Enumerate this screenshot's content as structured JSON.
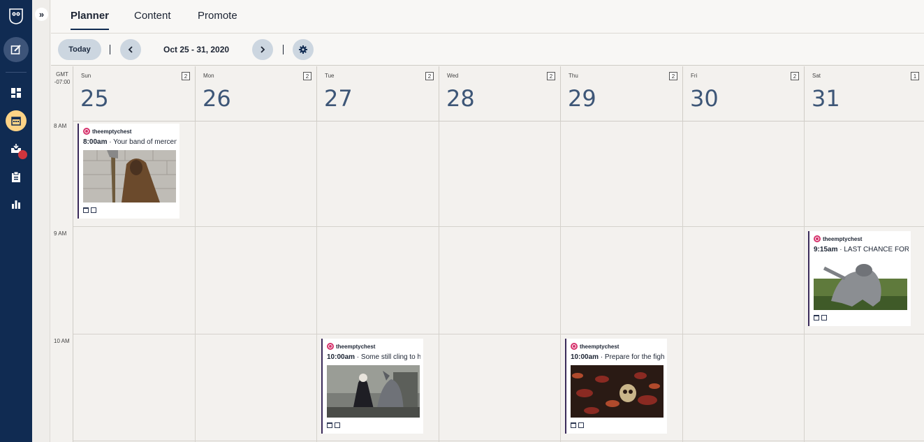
{
  "tabs": [
    {
      "label": "Planner"
    },
    {
      "label": "Content"
    },
    {
      "label": "Promote"
    }
  ],
  "collapse_label": "»",
  "toolbar": {
    "today_label": "Today",
    "date_range": "Oct 25 - 31, 2020"
  },
  "timezone": {
    "line1": "GMT",
    "line2": "-07:00"
  },
  "days": [
    {
      "dow": "Sun",
      "num": "25",
      "count": "2"
    },
    {
      "dow": "Mon",
      "num": "26",
      "count": "2"
    },
    {
      "dow": "Tue",
      "num": "27",
      "count": "2"
    },
    {
      "dow": "Wed",
      "num": "28",
      "count": "2"
    },
    {
      "dow": "Thu",
      "num": "29",
      "count": "2"
    },
    {
      "dow": "Fri",
      "num": "30",
      "count": "2"
    },
    {
      "dow": "Sat",
      "num": "31",
      "count": "1"
    }
  ],
  "times": [
    "8 AM",
    "9 AM",
    "10 AM"
  ],
  "posts": [
    {
      "account": "theemptychest",
      "time": "8:00am",
      "text": " · Your band of mercen",
      "image": "hooded-man-with-axe"
    },
    {
      "account": "theemptychest",
      "time": "9:15am",
      "text": " · LAST CHANCE FOR TI",
      "image": "gray-creature-statue"
    },
    {
      "account": "theemptychest",
      "time": "10:00am",
      "text": " · Some still cling to h",
      "image": "figure-with-werewolf"
    },
    {
      "account": "theemptychest",
      "time": "10:00am",
      "text": " · Prepare for the figh",
      "image": "skull-and-leaves"
    }
  ],
  "colors": {
    "sidebar": "#102b52",
    "accent_planner": "#fdd386",
    "notification": "#d0353d",
    "instagram": "#d6336c",
    "day_number": "#3d5677"
  }
}
